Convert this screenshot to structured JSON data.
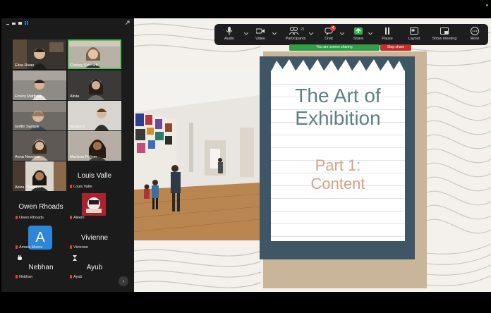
{
  "toolbar": {
    "audio": "Audio",
    "video": "Video",
    "participants": "Participants",
    "participants_count": "21",
    "chat": "Chat",
    "chat_badge": "4",
    "share": "Share",
    "pause": "Pause",
    "layout": "Layout",
    "show_meeting": "Show meeting",
    "more": "More"
  },
  "sharing_banner": {
    "status": "You are screen sharing",
    "stop": "Stop share"
  },
  "slide": {
    "title_line1": "The Art of",
    "title_line2": "Exhibition",
    "subtitle_line1": "Part 1:",
    "subtitle_line2": "Content"
  },
  "participants": {
    "video_tiles": [
      {
        "name": "Eliza Rivas"
      },
      {
        "name": "Chrissy Schmidt"
      },
      {
        "name": "Emery Matthew"
      },
      {
        "name": "Alivia"
      },
      {
        "name": "Griffin Sample"
      },
      {
        "name": "brooks b"
      },
      {
        "name": "Anna Newman"
      },
      {
        "name": "Marlena Pullom"
      },
      {
        "name": "Aziza Chandler"
      }
    ],
    "name_tiles": {
      "louis_big": "Louis Valle",
      "louis_small": "Louis Valle",
      "owen_big": "Owen Rhoads",
      "owen_small": "Owen Rhoads",
      "aleem_small": "Aleem",
      "amara_small": "Amara Moore",
      "amara_initial": "A",
      "vivienne_big": "Vivienne",
      "vivienne_small": "Vivienne",
      "nebhan_big": "Nebhan",
      "nebhan_small": "Nebhan",
      "ayub_big": "Ayub",
      "ayub_small": "Ayub"
    }
  },
  "colors": {
    "accent_green": "#57c15a",
    "share_green": "#2f9e44",
    "stop_red": "#c2312b",
    "slide_title": "#5f7f83",
    "slide_subtitle": "#d79f84",
    "card_frame": "#3f5666"
  }
}
